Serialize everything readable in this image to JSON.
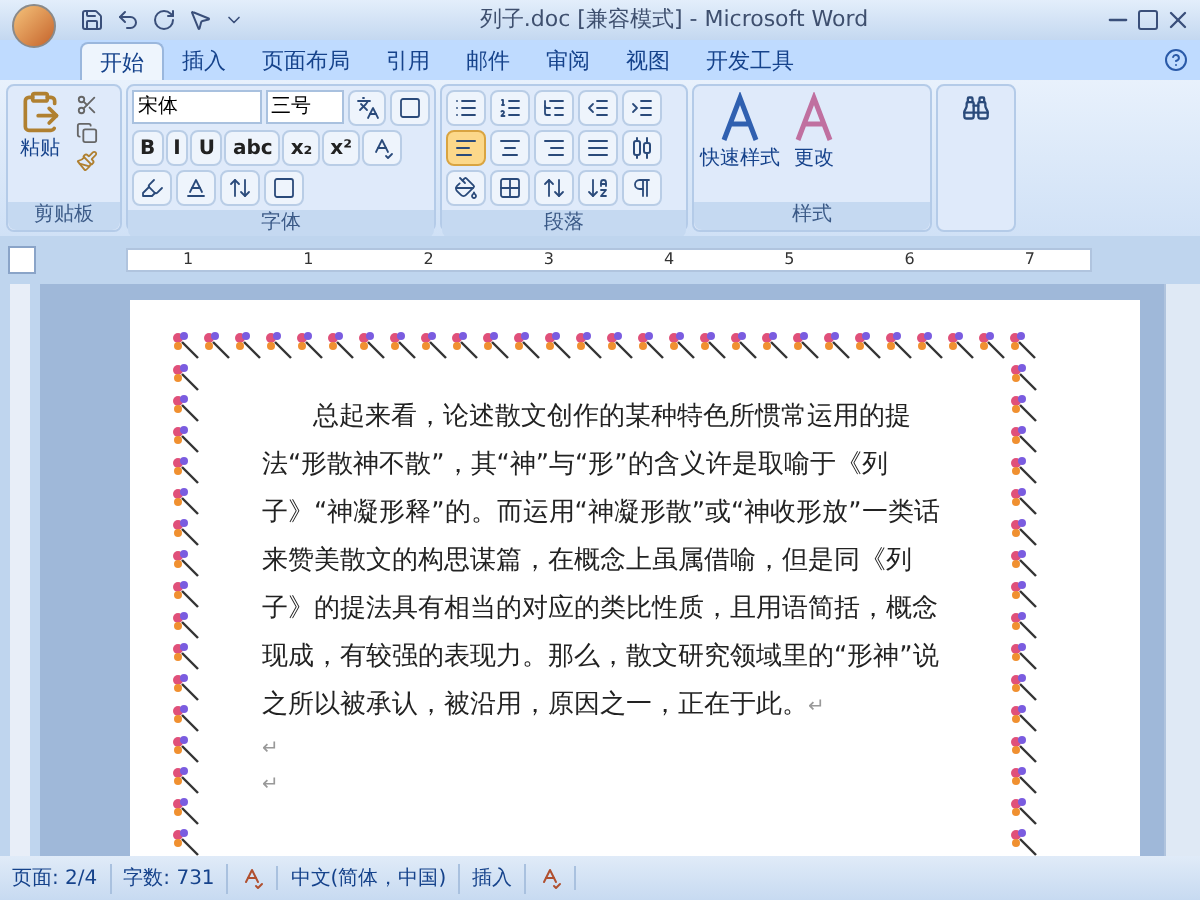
{
  "window": {
    "title": "列子.doc [兼容模式] - Microsoft Word"
  },
  "tabs": [
    {
      "label": "开始",
      "selected": true
    },
    {
      "label": "插入",
      "selected": false
    },
    {
      "label": "页面布局",
      "selected": false
    },
    {
      "label": "引用",
      "selected": false
    },
    {
      "label": "邮件",
      "selected": false
    },
    {
      "label": "审阅",
      "selected": false
    },
    {
      "label": "视图",
      "selected": false
    },
    {
      "label": "开发工具",
      "selected": false
    }
  ],
  "ribbon": {
    "clipboard": {
      "paste_label": "粘贴",
      "group_label": "剪贴板"
    },
    "font": {
      "font_name": "宋体",
      "font_size": "三号",
      "format_buttons": [
        "B",
        "I",
        "U",
        "abc",
        "x₂",
        "x²"
      ],
      "group_label": "字体"
    },
    "paragraph": {
      "alignments": [
        {
          "selected": true
        },
        {
          "selected": false
        },
        {
          "selected": false
        },
        {
          "selected": false
        },
        {
          "selected": false
        }
      ],
      "group_label": "段落"
    },
    "styles": {
      "buttons": [
        "快速样式",
        "更改"
      ],
      "group_label": "样式"
    }
  },
  "ruler": {
    "labels": [
      "1",
      "1",
      "2",
      "3",
      "4",
      "5",
      "6",
      "7"
    ]
  },
  "document": {
    "paragraph": "总起来看，论述散文创作的某种特色所惯常运用的提法“形散神不散”，其“神”与“形”的含义许是取喻于《列子》“神凝形释”的。而运用“神凝形散”或“神收形放”一类话来赞美散文的构思谋篇，在概念上虽属借喻，但是同《列子》的提法具有相当的对应的类比性质，且用语简括，概念现成，有较强的表现力。那么，散文研究领域里的“形神”说之所以被承认，被沿用，原因之一，正在于此。",
    "end_mark": "↵",
    "empty_lines": [
      "↵",
      "↵"
    ]
  },
  "status_bar": {
    "items": [
      {
        "kind": "text",
        "label": "页面: 2/4"
      },
      {
        "kind": "text",
        "label": "字数: 731"
      },
      {
        "kind": "icon"
      },
      {
        "kind": "text",
        "label": "中文(简体，中国)"
      },
      {
        "kind": "text",
        "label": "插入"
      },
      {
        "kind": "icon"
      }
    ]
  }
}
